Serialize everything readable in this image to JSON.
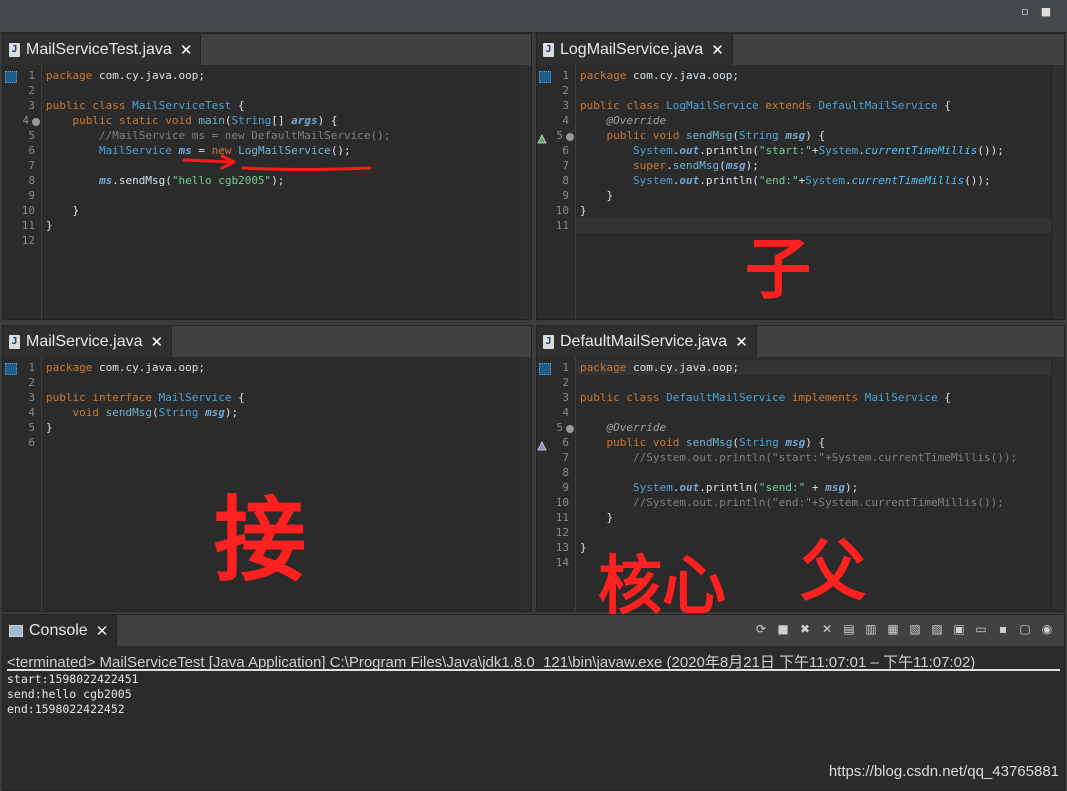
{
  "window": {
    "controls": [
      "▫",
      "■"
    ]
  },
  "editors": [
    {
      "tab": "MailServiceTest.java",
      "lines": [
        [
          [
            "kw",
            "package"
          ],
          [
            "pk",
            " com.cy.java.oop;"
          ]
        ],
        [],
        [
          [
            "kw",
            "public class "
          ],
          [
            "ty",
            "MailServiceTest"
          ],
          [
            "pk",
            " {"
          ]
        ],
        [
          [
            "pk",
            "    "
          ],
          [
            "kw",
            "public static void "
          ],
          [
            "fn",
            "main"
          ],
          [
            "pk",
            "("
          ],
          [
            "ty",
            "String"
          ],
          [
            "pk",
            "[] "
          ],
          [
            "fld",
            "args"
          ],
          [
            "pk",
            ") {"
          ]
        ],
        [
          [
            "cm",
            "        //MailService ms = new DefaultMailService();"
          ]
        ],
        [
          [
            "pk",
            "        "
          ],
          [
            "ty",
            "MailService"
          ],
          [
            "pk",
            " "
          ],
          [
            "fld",
            "ms"
          ],
          [
            "pk",
            " = "
          ],
          [
            "kw",
            "new "
          ],
          [
            "fn",
            "LogMailService"
          ],
          [
            "pk",
            "();"
          ]
        ],
        [],
        [
          [
            "pk",
            "        "
          ],
          [
            "fld",
            "ms"
          ],
          [
            "pk",
            ".sendMsg("
          ],
          [
            "st",
            "\"hello cgb2005\""
          ],
          [
            "pk",
            ");"
          ]
        ],
        [],
        [
          [
            "pk",
            "    }"
          ]
        ],
        [
          [
            "pk",
            "}"
          ]
        ],
        []
      ],
      "numbers": [
        "1",
        "2",
        "3",
        "4",
        "5",
        "6",
        "7",
        "8",
        "9",
        "10",
        "11",
        "12"
      ]
    },
    {
      "tab": "LogMailService.java",
      "lines": [
        [
          [
            "kw",
            "package"
          ],
          [
            "pk",
            " com.cy.java.oop;"
          ]
        ],
        [],
        [
          [
            "kw",
            "public class "
          ],
          [
            "ty",
            "LogMailService"
          ],
          [
            "kw",
            " extends "
          ],
          [
            "ty",
            "DefaultMailService"
          ],
          [
            "pk",
            " {"
          ]
        ],
        [
          [
            "pk",
            "    "
          ],
          [
            "an",
            "@Override"
          ]
        ],
        [
          [
            "pk",
            "    "
          ],
          [
            "kw",
            "public void "
          ],
          [
            "fn",
            "sendMsg"
          ],
          [
            "pk",
            "("
          ],
          [
            "ty",
            "String"
          ],
          [
            "pk",
            " "
          ],
          [
            "fld",
            "msg"
          ],
          [
            "pk",
            ") {"
          ]
        ],
        [
          [
            "pk",
            "        "
          ],
          [
            "ty",
            "System"
          ],
          [
            "pk",
            "."
          ],
          [
            "fld",
            "out"
          ],
          [
            "pk",
            ".println("
          ],
          [
            "st",
            "\"start:\""
          ],
          [
            "pk",
            "+"
          ],
          [
            "ty",
            "System"
          ],
          [
            "pk",
            "."
          ],
          [
            "mth",
            "currentTimeMillis"
          ],
          [
            "pk",
            "());"
          ]
        ],
        [
          [
            "pk",
            "        "
          ],
          [
            "kw",
            "super"
          ],
          [
            "pk",
            "."
          ],
          [
            "fn",
            "sendMsg"
          ],
          [
            "pk",
            "("
          ],
          [
            "fld",
            "msg"
          ],
          [
            "pk",
            ");"
          ]
        ],
        [
          [
            "pk",
            "        "
          ],
          [
            "ty",
            "System"
          ],
          [
            "pk",
            "."
          ],
          [
            "fld",
            "out"
          ],
          [
            "pk",
            ".println("
          ],
          [
            "st",
            "\"end:\""
          ],
          [
            "pk",
            "+"
          ],
          [
            "ty",
            "System"
          ],
          [
            "pk",
            "."
          ],
          [
            "mth",
            "currentTimeMillis"
          ],
          [
            "pk",
            "());"
          ]
        ],
        [
          [
            "pk",
            "    }"
          ]
        ],
        [
          [
            "pk",
            "}"
          ]
        ],
        []
      ],
      "numbers": [
        "1",
        "2",
        "3",
        "4",
        "5",
        "6",
        "7",
        "8",
        "9",
        "10",
        "11"
      ]
    },
    {
      "tab": "MailService.java",
      "lines": [
        [
          [
            "kw",
            "package"
          ],
          [
            "pk",
            " com.cy.java.oop;"
          ]
        ],
        [],
        [
          [
            "kw",
            "public interface "
          ],
          [
            "ty",
            "MailService"
          ],
          [
            "pk",
            " {"
          ]
        ],
        [
          [
            "pk",
            "    "
          ],
          [
            "kw",
            "void "
          ],
          [
            "fn",
            "sendMsg"
          ],
          [
            "pk",
            "("
          ],
          [
            "ty",
            "String"
          ],
          [
            "pk",
            " "
          ],
          [
            "fld",
            "msg"
          ],
          [
            "pk",
            ");"
          ]
        ],
        [
          [
            "pk",
            "}"
          ]
        ],
        []
      ],
      "numbers": [
        "1",
        "2",
        "3",
        "4",
        "5",
        "6"
      ]
    },
    {
      "tab": "DefaultMailService.java",
      "lines": [
        [
          [
            "kw",
            "package"
          ],
          [
            "pk",
            " com.cy.java.oop;"
          ]
        ],
        [],
        [
          [
            "kw",
            "public class "
          ],
          [
            "ty",
            "DefaultMailService"
          ],
          [
            "kw",
            " implements "
          ],
          [
            "ty",
            "MailService"
          ],
          [
            "pk",
            " {"
          ]
        ],
        [],
        [
          [
            "pk",
            "    "
          ],
          [
            "an",
            "@Override"
          ]
        ],
        [
          [
            "pk",
            "    "
          ],
          [
            "kw",
            "public void "
          ],
          [
            "fn",
            "sendMsg"
          ],
          [
            "pk",
            "("
          ],
          [
            "ty",
            "String"
          ],
          [
            "pk",
            " "
          ],
          [
            "fld",
            "msg"
          ],
          [
            "pk",
            ") {"
          ]
        ],
        [
          [
            "cm",
            "        //System.out.println(\"start:\"+System.currentTimeMillis());"
          ]
        ],
        [],
        [
          [
            "pk",
            "        "
          ],
          [
            "ty",
            "System"
          ],
          [
            "pk",
            "."
          ],
          [
            "fld",
            "out"
          ],
          [
            "pk",
            ".println("
          ],
          [
            "st",
            "\"send:\""
          ],
          [
            "pk",
            " + "
          ],
          [
            "fld",
            "msg"
          ],
          [
            "pk",
            ");"
          ]
        ],
        [
          [
            "cm",
            "        //System.out.println(\"end:\"+System.currentTimeMillis());"
          ]
        ],
        [
          [
            "pk",
            "    }"
          ]
        ],
        [],
        [
          [
            "pk",
            "}"
          ]
        ],
        []
      ],
      "numbers": [
        "1",
        "2",
        "3",
        "4",
        "5",
        "6",
        "7",
        "8",
        "9",
        "10",
        "11",
        "12",
        "13",
        "14"
      ]
    }
  ],
  "console": {
    "tab": "Console",
    "title": "<terminated> MailServiceTest [Java Application] C:\\Program Files\\Java\\jdk1.8.0_121\\bin\\javaw.exe  (2020年8月21日 下午11:07:01 – 下午11:07:02)",
    "output": [
      "start:1598022422451",
      "send:hello cgb2005",
      "end:1598022422452"
    ],
    "toolbar_icons": [
      "refresh-icon",
      "stop-icon",
      "remove-launch-icon",
      "remove-all-icon",
      "scroll-lock-icon",
      "word-wrap-icon",
      "show-stdout-icon",
      "show-stderr-icon",
      "pin-console-icon",
      "new-console-icon",
      "display-console-icon",
      "open-console-icon",
      "minimize-icon",
      "maximize-icon"
    ],
    "toolbar_glyphs": [
      "⟳",
      "■",
      "✖",
      "✕",
      "▤",
      "▥",
      "▦",
      "▧",
      "▨",
      "▣",
      "▭",
      "▪",
      "▢",
      "◉"
    ]
  },
  "annotations": [
    "子",
    "接",
    "核心",
    "父"
  ],
  "watermark": "https://blog.csdn.net/qq_43765881"
}
